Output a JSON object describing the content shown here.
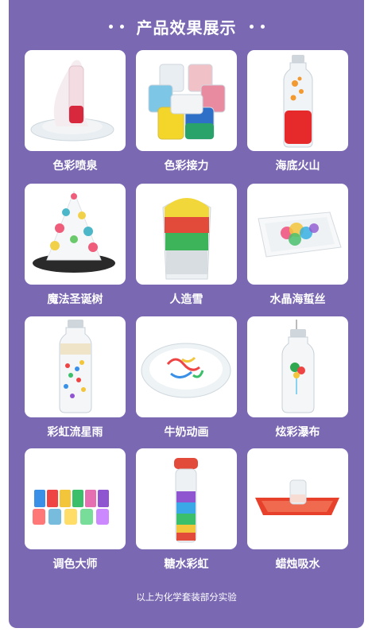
{
  "header": {
    "title": "产品效果展示"
  },
  "items": [
    {
      "label": "色彩喷泉",
      "icon": "color-fountain-image"
    },
    {
      "label": "色彩接力",
      "icon": "color-relay-image"
    },
    {
      "label": "海底火山",
      "icon": "undersea-volcano-image"
    },
    {
      "label": "魔法圣诞树",
      "icon": "magic-christmas-tree-image"
    },
    {
      "label": "人造雪",
      "icon": "artificial-snow-image"
    },
    {
      "label": "水晶海蜇丝",
      "icon": "crystal-jellyfish-image"
    },
    {
      "label": "彩虹流星雨",
      "icon": "rainbow-meteor-shower-image"
    },
    {
      "label": "牛奶动画",
      "icon": "milk-animation-image"
    },
    {
      "label": "炫彩瀑布",
      "icon": "dazzling-waterfall-image"
    },
    {
      "label": "调色大师",
      "icon": "color-mixing-master-image"
    },
    {
      "label": "糖水彩虹",
      "icon": "sugar-water-rainbow-image"
    },
    {
      "label": "蜡烛吸水",
      "icon": "candle-absorbs-water-image"
    }
  ],
  "footer": {
    "text": "以上为化学套装部分实验"
  },
  "colors": {
    "panel": "#7a68b3",
    "card": "#ffffff",
    "text": "#ffffff"
  }
}
